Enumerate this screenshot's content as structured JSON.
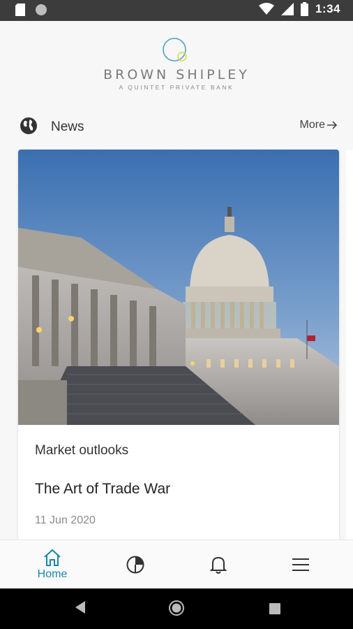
{
  "status_bar": {
    "time": "1:34",
    "icons": [
      "sd-card-icon",
      "circle-notification-icon",
      "wifi-icon",
      "cellular-signal-icon",
      "battery-icon"
    ]
  },
  "brand": {
    "name": "BROWN SHIPLEY",
    "tagline": "A QUINTET PRIVATE BANK",
    "accent_colors": [
      "#4aa3c8",
      "#d8d84a"
    ]
  },
  "news_section": {
    "title": "News",
    "more_label": "More",
    "icon": "globe-icon"
  },
  "article": {
    "category": "Market outlooks",
    "title": "The Art of Trade War",
    "date": "11 Jun 2020"
  },
  "bottom_nav": {
    "items": [
      {
        "label": "Home",
        "icon": "home-icon",
        "active": true
      },
      {
        "label": "",
        "icon": "pie-chart-icon",
        "active": false
      },
      {
        "label": "",
        "icon": "bell-icon",
        "active": false
      },
      {
        "label": "",
        "icon": "menu-icon",
        "active": false
      }
    ],
    "active_color": "#1a86a8"
  },
  "system_nav": {
    "icons": [
      "back-icon",
      "home-circle-icon",
      "recents-icon"
    ]
  }
}
